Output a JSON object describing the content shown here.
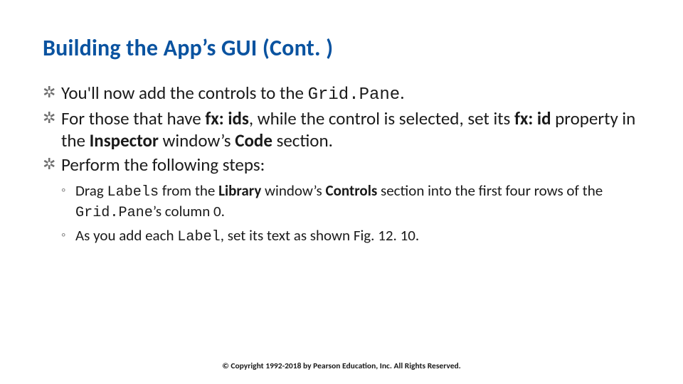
{
  "title": "Building the App’s GUI (Cont. )",
  "bullets": {
    "b1_pre": "You'll now add the controls to the ",
    "b1_code": "Grid.Pane",
    "b1_post": ".",
    "b2_a": "For those that have ",
    "b2_fxids": "fx: ids",
    "b2_b": ", while the control is selected, set its ",
    "b2_fxid": "fx: id",
    "b2_c": " property in the ",
    "b2_insp": "Inspector",
    "b2_d": " window’s ",
    "b2_codeword": "Code",
    "b2_e": " section.",
    "b3": "Perform the following steps:"
  },
  "sub": {
    "s1_a": "Drag ",
    "s1_labels": "Labels",
    "s1_b": " from the ",
    "s1_lib": "Library",
    "s1_c": " window’s ",
    "s1_ctrls": "Controls",
    "s1_d": " section into the first four rows of the ",
    "s1_gp": "Grid.Pane",
    "s1_e": "’s column 0.",
    "s2_a": "As you add each ",
    "s2_label": "Label",
    "s2_b": ", set its text as shown Fig. 12. 10."
  },
  "footer": "© Copyright 1992-2018 by Pearson Education, Inc. All Rights Reserved."
}
